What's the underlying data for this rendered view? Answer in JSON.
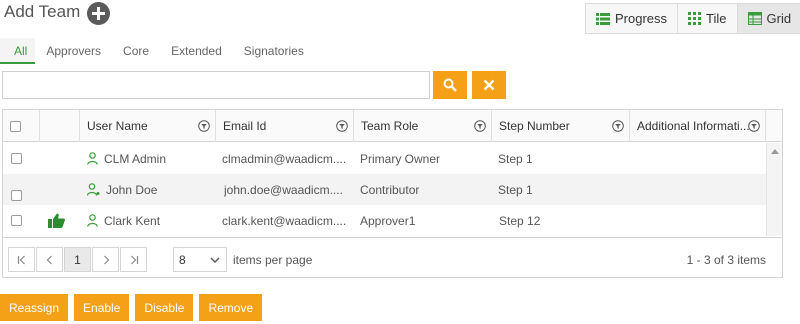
{
  "header": {
    "title": "Add Team",
    "view_options": [
      {
        "label": "Progress",
        "icon": "list-icon"
      },
      {
        "label": "Tile",
        "icon": "tile-icon"
      },
      {
        "label": "Grid",
        "icon": "grid-icon",
        "active": true
      }
    ]
  },
  "tabs": [
    {
      "label": "All",
      "active": true
    },
    {
      "label": "Approvers"
    },
    {
      "label": "Core"
    },
    {
      "label": "Extended"
    },
    {
      "label": "Signatories"
    }
  ],
  "search": {
    "value": "",
    "placeholder": "",
    "search_icon": "search-icon",
    "clear_icon": "close-icon"
  },
  "grid": {
    "columns": [
      "User Name",
      "Email Id",
      "Team Role",
      "Step Number",
      "Additional Informati..."
    ],
    "rows": [
      {
        "approved": false,
        "user_name": "CLM Admin",
        "user_icon": "user-icon",
        "email": "clmadmin@waadicm....",
        "team_role": "Primary Owner",
        "step": "Step 1"
      },
      {
        "approved": false,
        "user_name": "John Doe",
        "user_icon": "user-group-icon",
        "email": "john.doe@waadicm....",
        "team_role": "Contributor",
        "step": "Step 1"
      },
      {
        "approved": true,
        "user_name": "Clark Kent",
        "user_icon": "user-icon",
        "email": "clark.kent@waadicm....",
        "team_role": "Approver1",
        "step": "Step 12"
      }
    ]
  },
  "pager": {
    "current_page": "1",
    "page_size": "8",
    "per_page_label": "items per page",
    "summary": "1 - 3 of 3 items"
  },
  "actions": [
    "Reassign",
    "Enable",
    "Disable",
    "Remove"
  ],
  "colors": {
    "accent": "#f4a118",
    "green": "#3a9b3a"
  }
}
